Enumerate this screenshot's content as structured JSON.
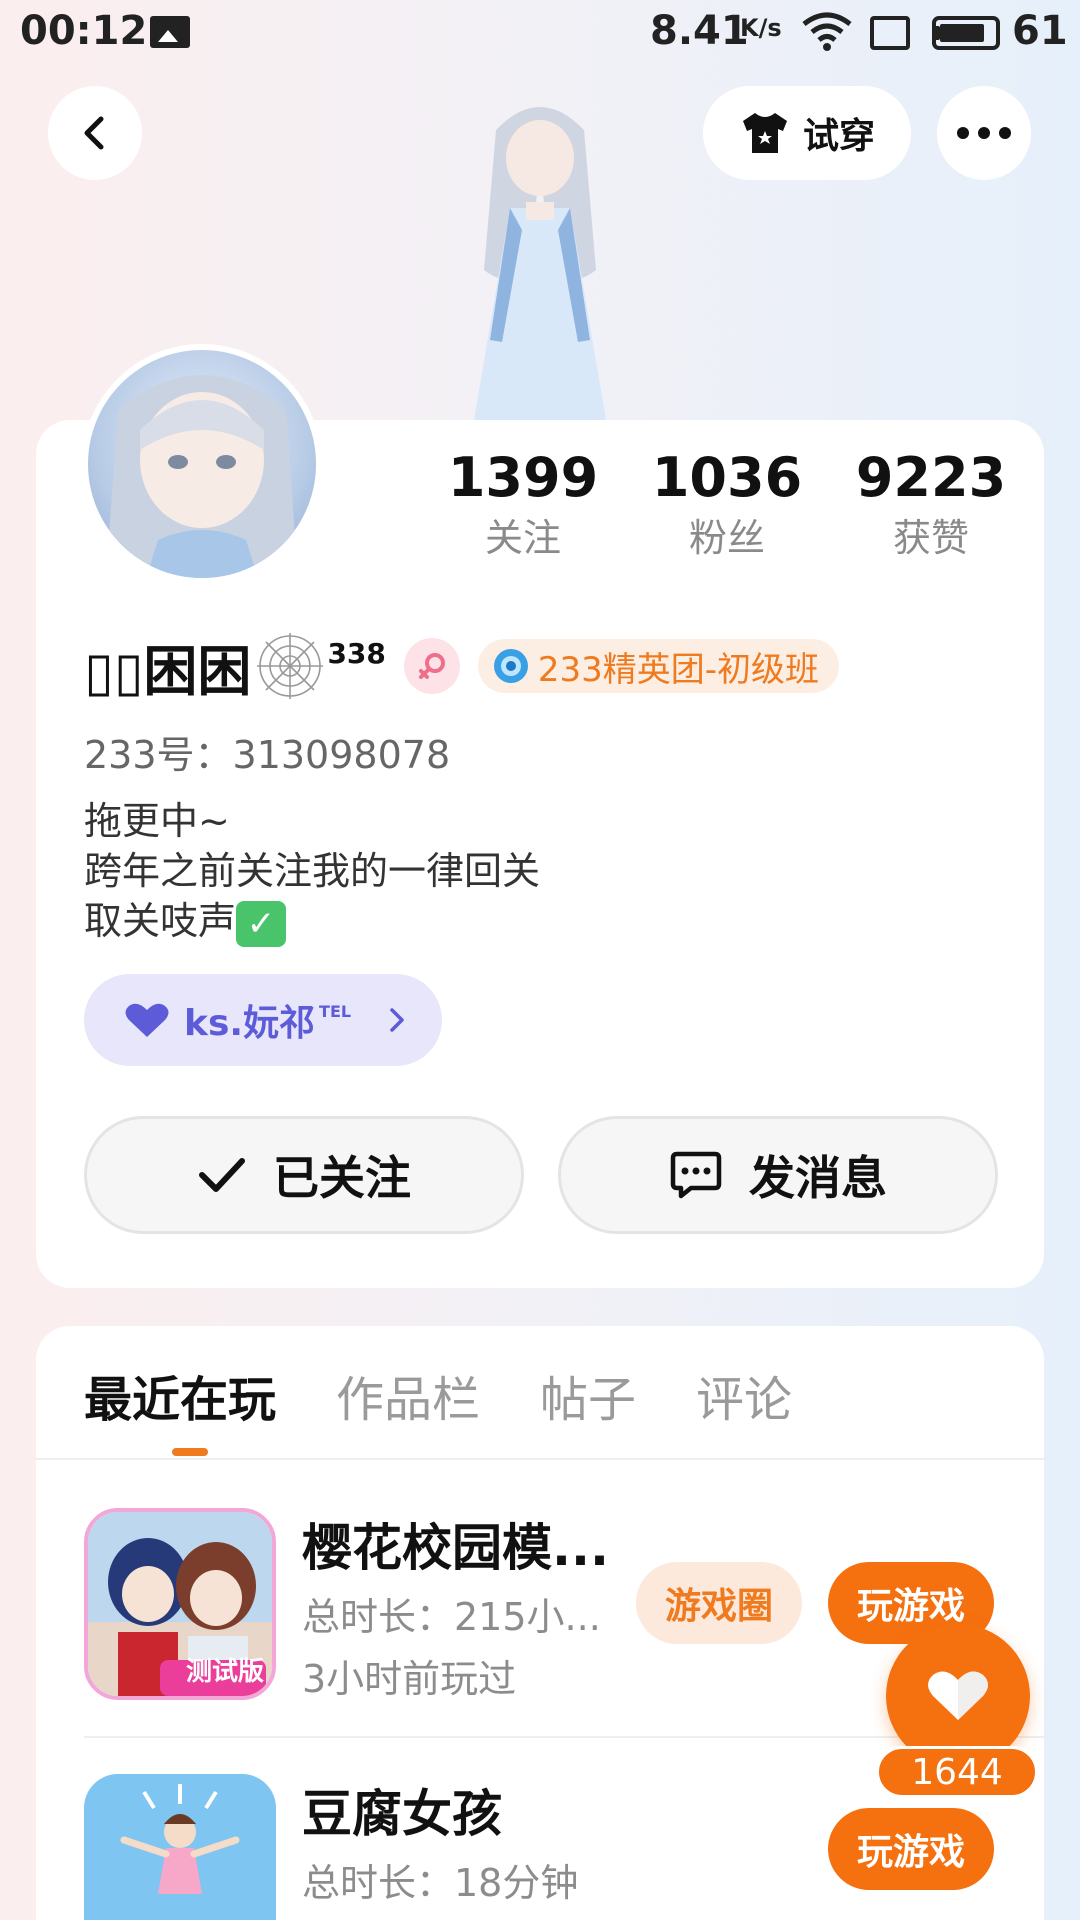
{
  "status_bar": {
    "time": "00:12",
    "speed": "8.41",
    "speed_unit": "K/s",
    "battery_level": "61"
  },
  "header": {
    "try_on_label": "试穿"
  },
  "profile": {
    "stats": [
      {
        "value": "1399",
        "label": "关注"
      },
      {
        "value": "1036",
        "label": "粉丝"
      },
      {
        "value": "9223",
        "label": "获赞"
      }
    ],
    "name": "▯▯困困",
    "level": "338",
    "team_badge": "233精英团-初级班",
    "id_line": "233号：313098078",
    "bio_lines": [
      "拖更中~",
      "跨年之前关注我的一律回关",
      "取关吱声"
    ],
    "bio_check": "✓",
    "tag": {
      "text": "ks.妧祁",
      "sup": "TEL"
    },
    "follow_label": "已关注",
    "message_label": "发消息"
  },
  "tabs": [
    "最近在玩",
    "作品栏",
    "帖子",
    "评论"
  ],
  "games": [
    {
      "title": "樱花校园模...",
      "duration": "总时长：215小...",
      "last_played": "3小时前玩过",
      "circle_label": "游戏圈",
      "play_label": "玩游戏",
      "icon_badge": "测试版"
    },
    {
      "title": "豆腐女孩",
      "duration": "总时长：18分钟",
      "play_label": "玩游戏"
    }
  ],
  "like": {
    "count": "1644"
  },
  "colors": {
    "accent": "#f5700f",
    "tag": "#5d5bd8"
  },
  "icons": [
    "back-icon",
    "shirt-icon",
    "more-icon",
    "spider-web-icon",
    "female-icon",
    "team-medal-icon",
    "heart-icon",
    "check-icon",
    "chat-icon",
    "like-heart-icon"
  ]
}
